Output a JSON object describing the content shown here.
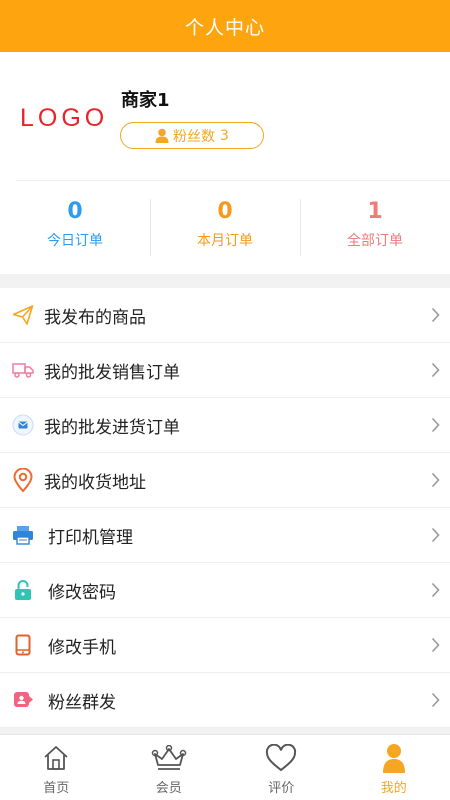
{
  "header": {
    "title": "个人中心"
  },
  "profile": {
    "logo_text": "LOGO",
    "shop_name": "商家1",
    "fans_label": "粉丝数",
    "fans_count": "3"
  },
  "stats": [
    {
      "value": "0",
      "label": "今日订单"
    },
    {
      "value": "0",
      "label": "本月订单"
    },
    {
      "value": "1",
      "label": "全部订单"
    }
  ],
  "menu": {
    "items": [
      {
        "label": "我发布的商品",
        "icon": "paper-plane-icon"
      },
      {
        "label": "我的批发销售订单",
        "icon": "truck-icon"
      },
      {
        "label": "我的批发进货订单",
        "icon": "envelope-icon"
      },
      {
        "label": "我的收货地址",
        "icon": "location-pin-icon"
      },
      {
        "label": "打印机管理",
        "icon": "printer-icon"
      },
      {
        "label": "修改密码",
        "icon": "lock-icon"
      },
      {
        "label": "修改手机",
        "icon": "phone-icon"
      },
      {
        "label": "粉丝群发",
        "icon": "fan-broadcast-icon"
      }
    ]
  },
  "tabbar": {
    "items": [
      {
        "label": "首页",
        "icon": "home-icon"
      },
      {
        "label": "会员",
        "icon": "crown-icon"
      },
      {
        "label": "评价",
        "icon": "heart-icon"
      },
      {
        "label": "我的",
        "icon": "user-icon"
      }
    ],
    "active_index": 3
  },
  "colors": {
    "accent": "#fda40f",
    "stat_today": "#2d9cf0",
    "stat_month": "#f59a1b",
    "stat_all": "#ef7b7b",
    "logo": "#e8242a"
  }
}
